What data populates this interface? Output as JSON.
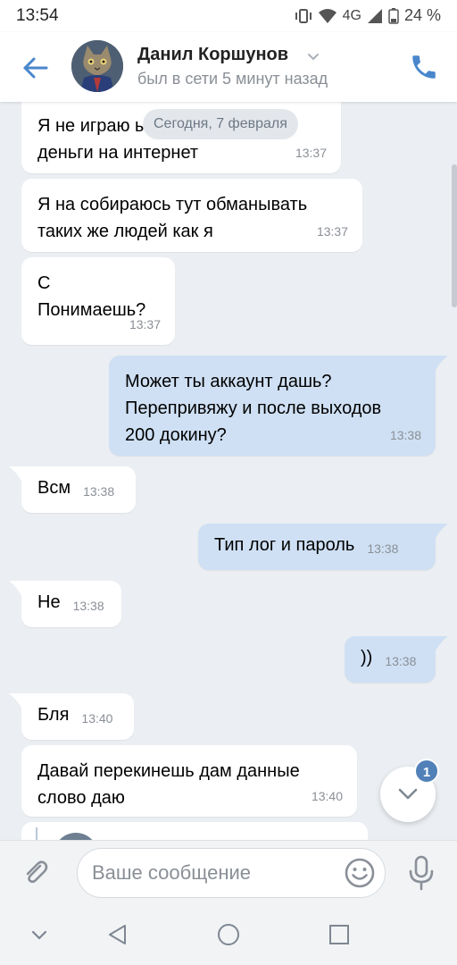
{
  "status_bar": {
    "time": "13:54",
    "network": "4G",
    "battery": "24 %"
  },
  "header": {
    "contact_name": "Данил Коршунов",
    "contact_status": "был в сети 5 минут назад",
    "accent_color": "#4986cc"
  },
  "chat": {
    "date_separator": "Сегодня, 7 февраля",
    "messages": [
      {
        "direction": "in",
        "text": "Я не играю          ы\nденьги на интернет",
        "time": "13:37"
      },
      {
        "direction": "in",
        "text": "Я на собираюсь тут обманывать\nтаких же людей как я",
        "time": "13:37"
      },
      {
        "direction": "in",
        "text": "С\nПонимаешь?",
        "time": "13:37"
      },
      {
        "direction": "out",
        "text": "Может ты аккаунт дашь?\nПерепривяжу и после выходов\n200 докину?",
        "time": "13:38"
      },
      {
        "direction": "in",
        "text": "Всм",
        "time": "13:38"
      },
      {
        "direction": "out",
        "text": "Тип лог и пароль",
        "time": "13:38"
      },
      {
        "direction": "in",
        "text": "Не",
        "time": "13:38"
      },
      {
        "direction": "out",
        "text": "))",
        "time": "13:38"
      },
      {
        "direction": "in",
        "text": "Бля",
        "time": "13:40"
      },
      {
        "direction": "in",
        "text": "Давай перекинешь дам данные\nслово даю",
        "time": "13:40"
      }
    ],
    "unread_count": "1"
  },
  "composer": {
    "placeholder": "Ваше сообщение"
  },
  "colors": {
    "incoming_bubble": "#ffffff",
    "outgoing_bubble": "#cfe0f4",
    "chat_background": "#ebeef2",
    "badge": "#5181b8"
  }
}
